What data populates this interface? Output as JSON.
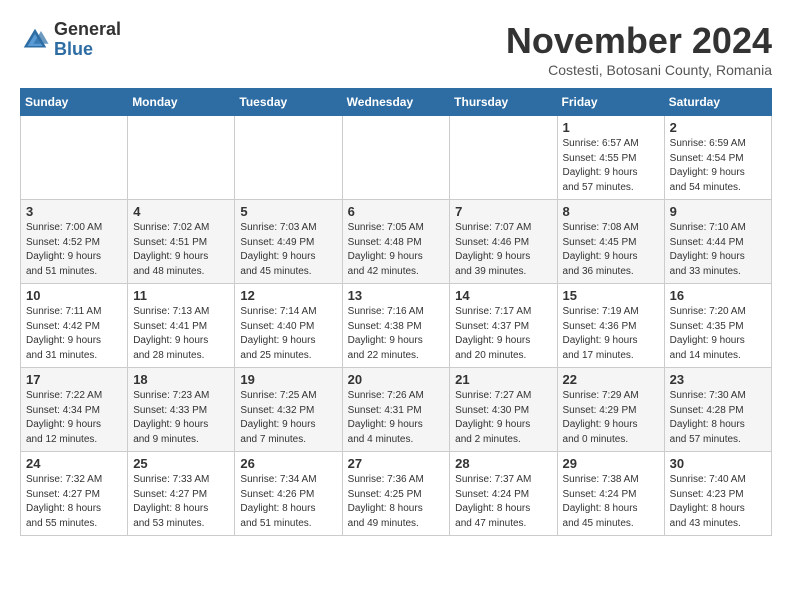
{
  "logo": {
    "line1": "General",
    "line2": "Blue"
  },
  "title": "November 2024",
  "location": "Costesti, Botosani County, Romania",
  "days_of_week": [
    "Sunday",
    "Monday",
    "Tuesday",
    "Wednesday",
    "Thursday",
    "Friday",
    "Saturday"
  ],
  "weeks": [
    [
      {
        "day": "",
        "info": ""
      },
      {
        "day": "",
        "info": ""
      },
      {
        "day": "",
        "info": ""
      },
      {
        "day": "",
        "info": ""
      },
      {
        "day": "",
        "info": ""
      },
      {
        "day": "1",
        "info": "Sunrise: 6:57 AM\nSunset: 4:55 PM\nDaylight: 9 hours\nand 57 minutes."
      },
      {
        "day": "2",
        "info": "Sunrise: 6:59 AM\nSunset: 4:54 PM\nDaylight: 9 hours\nand 54 minutes."
      }
    ],
    [
      {
        "day": "3",
        "info": "Sunrise: 7:00 AM\nSunset: 4:52 PM\nDaylight: 9 hours\nand 51 minutes."
      },
      {
        "day": "4",
        "info": "Sunrise: 7:02 AM\nSunset: 4:51 PM\nDaylight: 9 hours\nand 48 minutes."
      },
      {
        "day": "5",
        "info": "Sunrise: 7:03 AM\nSunset: 4:49 PM\nDaylight: 9 hours\nand 45 minutes."
      },
      {
        "day": "6",
        "info": "Sunrise: 7:05 AM\nSunset: 4:48 PM\nDaylight: 9 hours\nand 42 minutes."
      },
      {
        "day": "7",
        "info": "Sunrise: 7:07 AM\nSunset: 4:46 PM\nDaylight: 9 hours\nand 39 minutes."
      },
      {
        "day": "8",
        "info": "Sunrise: 7:08 AM\nSunset: 4:45 PM\nDaylight: 9 hours\nand 36 minutes."
      },
      {
        "day": "9",
        "info": "Sunrise: 7:10 AM\nSunset: 4:44 PM\nDaylight: 9 hours\nand 33 minutes."
      }
    ],
    [
      {
        "day": "10",
        "info": "Sunrise: 7:11 AM\nSunset: 4:42 PM\nDaylight: 9 hours\nand 31 minutes."
      },
      {
        "day": "11",
        "info": "Sunrise: 7:13 AM\nSunset: 4:41 PM\nDaylight: 9 hours\nand 28 minutes."
      },
      {
        "day": "12",
        "info": "Sunrise: 7:14 AM\nSunset: 4:40 PM\nDaylight: 9 hours\nand 25 minutes."
      },
      {
        "day": "13",
        "info": "Sunrise: 7:16 AM\nSunset: 4:38 PM\nDaylight: 9 hours\nand 22 minutes."
      },
      {
        "day": "14",
        "info": "Sunrise: 7:17 AM\nSunset: 4:37 PM\nDaylight: 9 hours\nand 20 minutes."
      },
      {
        "day": "15",
        "info": "Sunrise: 7:19 AM\nSunset: 4:36 PM\nDaylight: 9 hours\nand 17 minutes."
      },
      {
        "day": "16",
        "info": "Sunrise: 7:20 AM\nSunset: 4:35 PM\nDaylight: 9 hours\nand 14 minutes."
      }
    ],
    [
      {
        "day": "17",
        "info": "Sunrise: 7:22 AM\nSunset: 4:34 PM\nDaylight: 9 hours\nand 12 minutes."
      },
      {
        "day": "18",
        "info": "Sunrise: 7:23 AM\nSunset: 4:33 PM\nDaylight: 9 hours\nand 9 minutes."
      },
      {
        "day": "19",
        "info": "Sunrise: 7:25 AM\nSunset: 4:32 PM\nDaylight: 9 hours\nand 7 minutes."
      },
      {
        "day": "20",
        "info": "Sunrise: 7:26 AM\nSunset: 4:31 PM\nDaylight: 9 hours\nand 4 minutes."
      },
      {
        "day": "21",
        "info": "Sunrise: 7:27 AM\nSunset: 4:30 PM\nDaylight: 9 hours\nand 2 minutes."
      },
      {
        "day": "22",
        "info": "Sunrise: 7:29 AM\nSunset: 4:29 PM\nDaylight: 9 hours\nand 0 minutes."
      },
      {
        "day": "23",
        "info": "Sunrise: 7:30 AM\nSunset: 4:28 PM\nDaylight: 8 hours\nand 57 minutes."
      }
    ],
    [
      {
        "day": "24",
        "info": "Sunrise: 7:32 AM\nSunset: 4:27 PM\nDaylight: 8 hours\nand 55 minutes."
      },
      {
        "day": "25",
        "info": "Sunrise: 7:33 AM\nSunset: 4:27 PM\nDaylight: 8 hours\nand 53 minutes."
      },
      {
        "day": "26",
        "info": "Sunrise: 7:34 AM\nSunset: 4:26 PM\nDaylight: 8 hours\nand 51 minutes."
      },
      {
        "day": "27",
        "info": "Sunrise: 7:36 AM\nSunset: 4:25 PM\nDaylight: 8 hours\nand 49 minutes."
      },
      {
        "day": "28",
        "info": "Sunrise: 7:37 AM\nSunset: 4:24 PM\nDaylight: 8 hours\nand 47 minutes."
      },
      {
        "day": "29",
        "info": "Sunrise: 7:38 AM\nSunset: 4:24 PM\nDaylight: 8 hours\nand 45 minutes."
      },
      {
        "day": "30",
        "info": "Sunrise: 7:40 AM\nSunset: 4:23 PM\nDaylight: 8 hours\nand 43 minutes."
      }
    ]
  ]
}
